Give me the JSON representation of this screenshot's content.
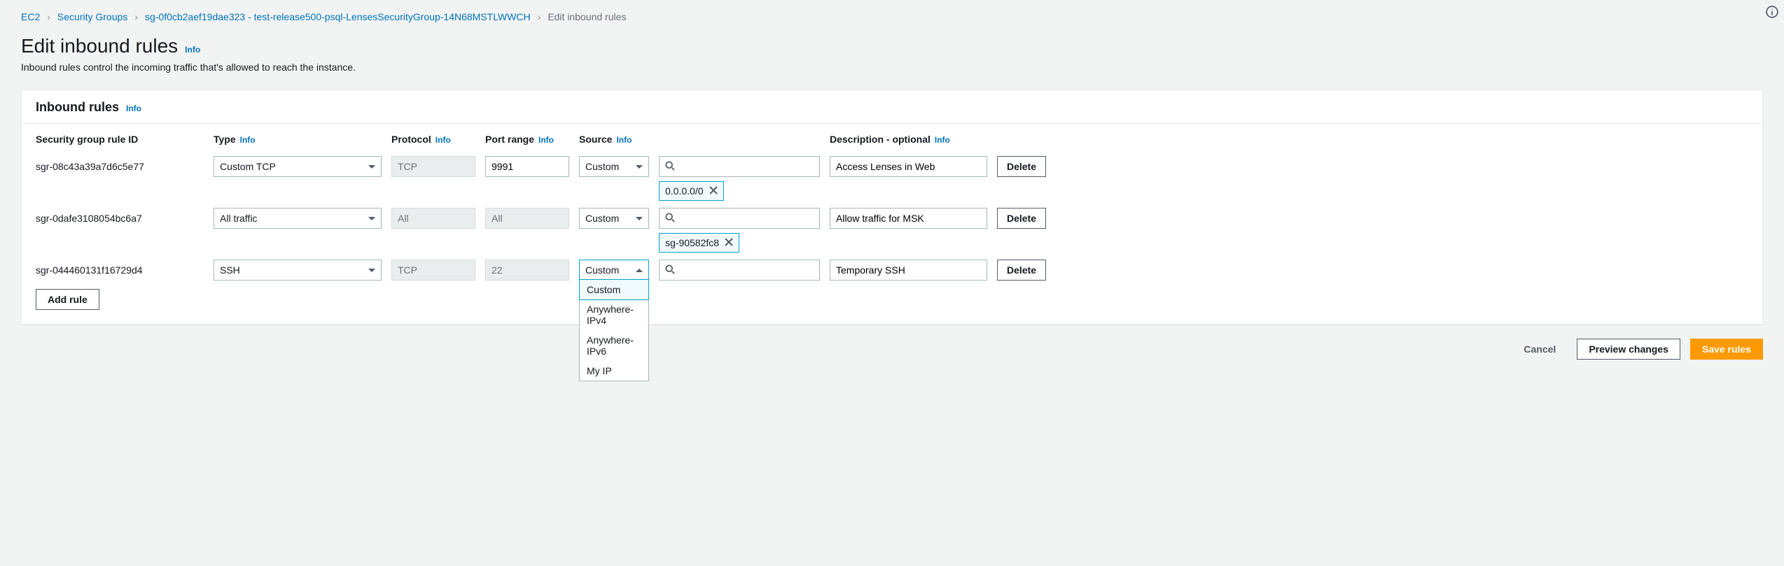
{
  "breadcrumbs": {
    "ec2": "EC2",
    "security_groups": "Security Groups",
    "sg_detail": "sg-0f0cb2aef19dae323 - test-release500-psql-LensesSecurityGroup-14N68MSTLWWCH",
    "current": "Edit inbound rules"
  },
  "page_title": "Edit inbound rules",
  "info_label": "Info",
  "subtitle": "Inbound rules control the incoming traffic that's allowed to reach the instance.",
  "panel_title": "Inbound rules",
  "headers": {
    "rule_id": "Security group rule ID",
    "type": "Type",
    "protocol": "Protocol",
    "port_range": "Port range",
    "source": "Source",
    "description": "Description - optional"
  },
  "rules": [
    {
      "id": "sgr-08c43a39a7d6c5e77",
      "type": "Custom TCP",
      "protocol": "TCP",
      "protocol_disabled": true,
      "port_range": "9991",
      "port_disabled": false,
      "source_mode": "Custom",
      "source_open": false,
      "source_chips": [
        "0.0.0.0/0"
      ],
      "description": "Access Lenses in Web"
    },
    {
      "id": "sgr-0dafe3108054bc6a7",
      "type": "All traffic",
      "protocol": "All",
      "protocol_disabled": true,
      "port_range": "All",
      "port_disabled": true,
      "source_mode": "Custom",
      "source_open": false,
      "source_chips": [
        "sg-90582fc8"
      ],
      "description": "Allow traffic for MSK"
    },
    {
      "id": "sgr-044460131f16729d4",
      "type": "SSH",
      "protocol": "TCP",
      "protocol_disabled": true,
      "port_range": "22",
      "port_disabled": true,
      "source_mode": "Custom",
      "source_open": true,
      "source_chips": [],
      "description": "Temporary SSH"
    }
  ],
  "source_options": [
    "Custom",
    "Anywhere-IPv4",
    "Anywhere-IPv6",
    "My IP"
  ],
  "buttons": {
    "delete": "Delete",
    "add_rule": "Add rule",
    "cancel": "Cancel",
    "preview": "Preview changes",
    "save": "Save rules"
  }
}
